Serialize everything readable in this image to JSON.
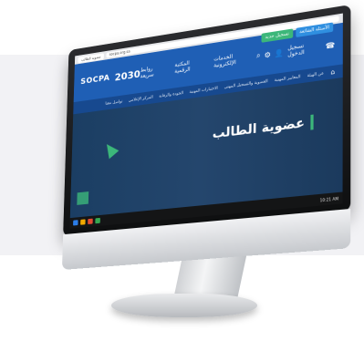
{
  "browser": {
    "tab_label": "عضوية الطالب",
    "url": "socpa.org.sa"
  },
  "header": {
    "logo": "SOCPA",
    "vision": "2030",
    "login_label": "تسجيل الدخول",
    "nav_items": [
      "الخدمات الإلكترونية",
      "المكتبة الرقمية",
      "روابط سريعة"
    ],
    "button_register": "تسجيل جديد",
    "button_questions": "الأسئلة الشائعة"
  },
  "secondary_nav": {
    "items": [
      "عن الهيئة",
      "المعايير المهنية",
      "العضوية والتسجيل المهني",
      "الاختبارات المهنية",
      "الجودة والرقابة",
      "المركز الإعلامي",
      "تواصل معنا"
    ]
  },
  "hero": {
    "title": "عضوية الطالب"
  },
  "taskbar": {
    "time": "10:21 AM"
  },
  "colors": {
    "primary_blue": "#1f5fb5",
    "dark_blue": "#17498f",
    "green": "#3cb77a",
    "hero_bg": "#1b3e63"
  }
}
